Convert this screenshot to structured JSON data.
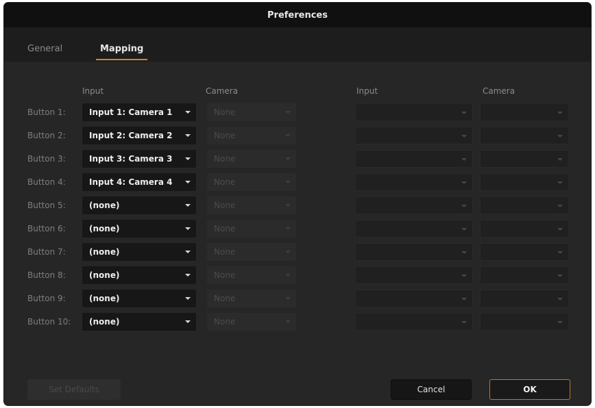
{
  "window": {
    "title": "Preferences"
  },
  "tabs": [
    {
      "label": "General",
      "selected": false
    },
    {
      "label": "Mapping",
      "selected": true
    }
  ],
  "columns": {
    "left_input": "Input",
    "left_camera": "Camera",
    "right_input": "Input",
    "right_camera": "Camera"
  },
  "rows": [
    {
      "label": "Button 1:",
      "input": "Input 1: Camera 1",
      "camera": "None"
    },
    {
      "label": "Button 2:",
      "input": "Input 2: Camera 2",
      "camera": "None"
    },
    {
      "label": "Button 3:",
      "input": "Input 3: Camera 3",
      "camera": "None"
    },
    {
      "label": "Button 4:",
      "input": "Input 4: Camera 4",
      "camera": "None"
    },
    {
      "label": "Button 5:",
      "input": "(none)",
      "camera": "None"
    },
    {
      "label": "Button 6:",
      "input": "(none)",
      "camera": "None"
    },
    {
      "label": "Button 7:",
      "input": "(none)",
      "camera": "None"
    },
    {
      "label": "Button 8:",
      "input": "(none)",
      "camera": "None"
    },
    {
      "label": "Button 9:",
      "input": "(none)",
      "camera": "None"
    },
    {
      "label": "Button 10:",
      "input": "(none)",
      "camera": "None"
    }
  ],
  "buttons": {
    "set_defaults": "Set Defaults",
    "cancel": "Cancel",
    "ok": "OK"
  },
  "colors": {
    "accent": "#d9822b",
    "window_bg": "#262626",
    "titlebar_bg": "#101010"
  }
}
